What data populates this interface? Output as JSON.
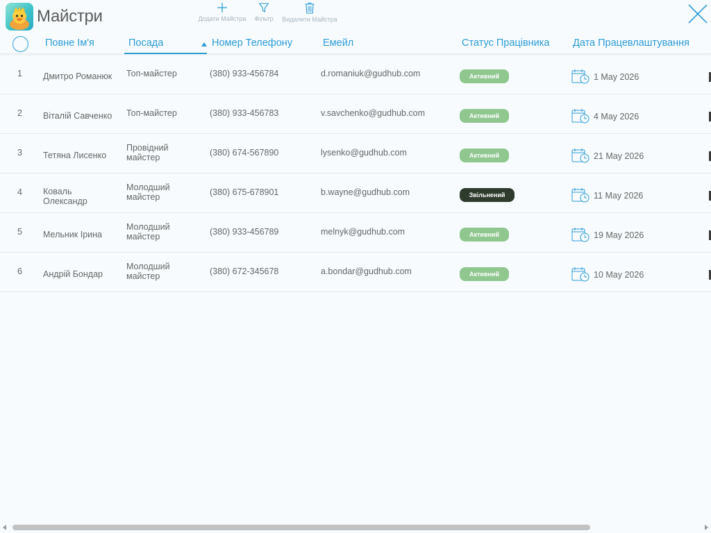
{
  "app": {
    "title": "Майстри"
  },
  "toolbar": {
    "add_label": "Додати Майстра",
    "filter_label": "Фільтр",
    "delete_label": "Видалити Майстра"
  },
  "columns": {
    "name": "Повне Ім'я",
    "position": "Посада",
    "phone": "Номер Телефону",
    "email": "Емейл",
    "status": "Статус Працівника",
    "hire_date": "Дата Працевлаштування"
  },
  "rows": [
    {
      "num": "1",
      "name": "Дмитро Романюк",
      "position": "Топ-майстер",
      "phone": "(380) 933-456784",
      "email": "d.romaniuk@gudhub.com",
      "status": "Активний",
      "date": "1 May 2026"
    },
    {
      "num": "2",
      "name": "Віталій Савченко",
      "position": "Топ-майстер",
      "phone": "(380) 933-456783",
      "email": "v.savchenko@gudhub.com",
      "status": "Активний",
      "date": "4 May 2026"
    },
    {
      "num": "3",
      "name": "Тетяна Лисенко",
      "position": "Провідний майстер",
      "phone": "(380) 674-567890",
      "email": "lysenko@gudhub.com",
      "status": "Активний",
      "date": "21 May 2026"
    },
    {
      "num": "4",
      "name": "Коваль Олександр",
      "position": "Молодший майстер",
      "phone": "(380) 675-678901",
      "email": "b.wayne@gudhub.com",
      "status": "Звільнений",
      "date": "11 May 2026"
    },
    {
      "num": "5",
      "name": "Мельник Ірина",
      "position": "Молодший майстер",
      "phone": "(380) 933-456789",
      "email": "melnyk@gudhub.com",
      "status": "Активний",
      "date": "19 May 2026"
    },
    {
      "num": "6",
      "name": "Андрій Бондар",
      "position": "Молодший майстер",
      "phone": "(380) 672-345678",
      "email": "a.bondar@gudhub.com",
      "status": "Активний",
      "date": "10 May 2026"
    }
  ],
  "colors": {
    "accent": "#2b9bd6",
    "status_active": "#8fc78f",
    "status_fired": "#2e3b2d"
  },
  "icons": {
    "app": "duck-avatar-icon",
    "add": "plus-icon",
    "filter": "funnel-icon",
    "delete": "trash-icon",
    "close": "close-icon",
    "date": "calendar-clock-icon"
  }
}
